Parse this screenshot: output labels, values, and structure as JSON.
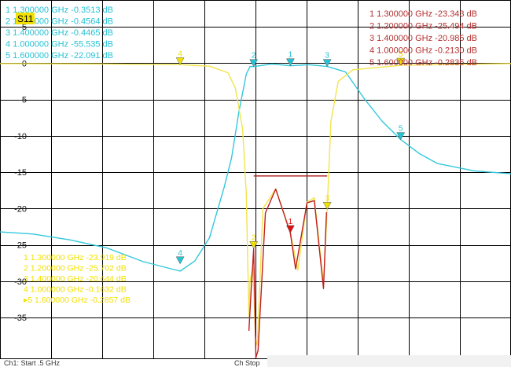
{
  "chart_data": {
    "type": "line",
    "trace_label": "S11",
    "xlim": [
      0.51,
      1.9
    ],
    "ylim": [
      -40.6,
      8.7
    ],
    "y_ticks": [
      5,
      0,
      -5,
      -10,
      -15,
      -20,
      -25,
      -30,
      -35
    ],
    "y_tick_labels": [
      "5",
      "0",
      "-5",
      "-10",
      "-15",
      "-20",
      "-25",
      "-30",
      "-35"
    ],
    "grid": true,
    "colors": {
      "s21_trace": "#33c8dc",
      "s11_trace": "#f2e44a",
      "s11_trace_alt": "#c0201e",
      "marker_yellow": "#f2e100",
      "marker_cyan": "#25c3d5",
      "marker_red": "#d11",
      "spec_line": "#b53030"
    },
    "series": [
      {
        "color_key": "s21_trace",
        "points": [
          [
            0.51,
            -23.2
          ],
          [
            0.6,
            -23.5
          ],
          [
            0.7,
            -24.3
          ],
          [
            0.8,
            -25.4
          ],
          [
            0.9,
            -27.3
          ],
          [
            1.0,
            -28.6
          ],
          [
            1.04,
            -27.2
          ],
          [
            1.08,
            -24.0
          ],
          [
            1.12,
            -17.0
          ],
          [
            1.14,
            -13.0
          ],
          [
            1.16,
            -6.6
          ],
          [
            1.18,
            -1.5
          ],
          [
            1.19,
            -0.45
          ],
          [
            1.2,
            -0.46
          ],
          [
            1.25,
            -0.1
          ],
          [
            1.3,
            -0.35
          ],
          [
            1.35,
            -0.2
          ],
          [
            1.4,
            -0.45
          ],
          [
            1.45,
            -1.2
          ],
          [
            1.5,
            -4.8
          ],
          [
            1.55,
            -8.0
          ],
          [
            1.6,
            -10.5
          ],
          [
            1.65,
            -12.4
          ],
          [
            1.7,
            -13.8
          ],
          [
            1.8,
            -14.8
          ],
          [
            1.9,
            -15.2
          ]
        ]
      },
      {
        "color_key": "s11_trace",
        "points": [
          [
            0.51,
            -0.05
          ],
          [
            0.8,
            -0.1
          ],
          [
            1.0,
            -0.2
          ],
          [
            1.08,
            -0.4
          ],
          [
            1.13,
            -1.3
          ],
          [
            1.15,
            -3.4
          ],
          [
            1.17,
            -9.0
          ],
          [
            1.18,
            -18.0
          ],
          [
            1.187,
            -34.8
          ],
          [
            1.19,
            -30.0
          ],
          [
            1.198,
            -28.0
          ],
          [
            1.205,
            -37.8
          ],
          [
            1.21,
            -38.8
          ],
          [
            1.225,
            -20.0
          ],
          [
            1.26,
            -17.3
          ],
          [
            1.3,
            -23.3
          ],
          [
            1.32,
            -28.5
          ],
          [
            1.345,
            -19.1
          ],
          [
            1.365,
            -18.5
          ],
          [
            1.39,
            -30.3
          ],
          [
            1.4,
            -20.1
          ],
          [
            1.41,
            -8.0
          ],
          [
            1.43,
            -2.5
          ],
          [
            1.47,
            -0.9
          ],
          [
            1.6,
            -0.28
          ],
          [
            1.9,
            -0.05
          ]
        ]
      },
      {
        "color_key": "s11_trace_alt",
        "points": [
          [
            1.187,
            -36.8
          ],
          [
            1.194,
            -30.4
          ],
          [
            1.2,
            -25.5
          ],
          [
            1.206,
            -40.5
          ],
          [
            1.212,
            -39.5
          ],
          [
            1.232,
            -20.6
          ],
          [
            1.26,
            -17.3
          ],
          [
            1.3,
            -23.4
          ],
          [
            1.314,
            -28.3
          ],
          [
            1.345,
            -19.2
          ],
          [
            1.365,
            -18.9
          ],
          [
            1.39,
            -31.0
          ],
          [
            1.398,
            -20.5
          ]
        ]
      }
    ],
    "spec_line": {
      "x": [
        1.2,
        1.4
      ],
      "y": -15.5
    },
    "markers": [
      {
        "label": "1",
        "x": 1.3,
        "y": -0.35,
        "color_key": "marker_cyan"
      },
      {
        "label": "2",
        "x": 1.2,
        "y": -0.46,
        "color_key": "marker_cyan"
      },
      {
        "label": "3",
        "x": 1.4,
        "y": -0.45,
        "color_key": "marker_cyan"
      },
      {
        "label": "4",
        "x": 1.0,
        "y": -27.6,
        "color_key": "marker_cyan"
      },
      {
        "label": "5",
        "x": 1.6,
        "y": -10.5,
        "color_key": "marker_cyan"
      },
      {
        "label": "1",
        "x": 1.3,
        "y": -23.3,
        "color_key": "marker_red"
      },
      {
        "label": "2",
        "x": 1.2,
        "y": -25.5,
        "color_key": "marker_yellow"
      },
      {
        "label": "3",
        "x": 1.4,
        "y": -20.1,
        "color_key": "marker_yellow"
      },
      {
        "label": "4",
        "x": 1.0,
        "y": -0.21,
        "color_key": "marker_yellow"
      },
      {
        "label": "5",
        "x": 1.6,
        "y": -0.28,
        "color_key": "marker_yellow"
      }
    ],
    "marker_tables": [
      {
        "color_key": "marker_cyan",
        "rows": [
          "1  1.300000 GHz -0.3513 dB",
          "2  1.200000 GHz -0.4564 dB",
          "3  1.400000 GHz -0.4465 dB",
          "4  1.000000 GHz -55.535 dB",
          "5  1.600000 GHz -22.091 dB"
        ]
      },
      {
        "color_key": "spec_line",
        "rows": [
          "1   1.300000 GHz   -23.343 dB",
          "2   1.200000 GHz   -25.494 dB",
          "3   1.400000 GHz   -20.985 dB",
          "4   1.000000 GHz   -0.2130 dB",
          "5   1.600000 GHz   -0.2835 dB"
        ]
      },
      {
        "color_key": "marker_yellow",
        "rows": [
          "1  1.300000 GHz -23.919 dB",
          "2  1.200000 GHz -25.702 dB",
          "3  1.400000 GHz -20.644 dB",
          "4  1.000000 GHz -0.1632 dB",
          "▸5  1.600000 GHz -0.2857 dB"
        ]
      }
    ],
    "footer_left": "Ch1: Start  .5 GHz",
    "footer_right": "Ch Stop"
  }
}
